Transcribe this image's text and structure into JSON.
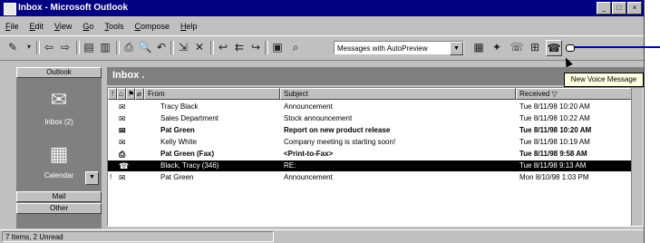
{
  "window": {
    "title": "Inbox - Microsoft Outlook",
    "controls": [
      "_",
      "□",
      "×"
    ]
  },
  "menu": [
    "File",
    "Edit",
    "View",
    "Go",
    "Tools",
    "Compose",
    "Help"
  ],
  "toolbar": {
    "view_selector": "Messages with AutoPreview",
    "tooltip": "New Voice Message"
  },
  "outlook_bar": {
    "header": "Outlook",
    "items": [
      {
        "label": "Inbox (2)",
        "icon": "inbox-icon"
      },
      {
        "label": "Calendar",
        "icon": "calendar-icon"
      }
    ],
    "groups": [
      "Mail",
      "Other"
    ]
  },
  "folder": {
    "title": "Inbox ."
  },
  "columns": {
    "from": "From",
    "subject": "Subject",
    "received": "Received"
  },
  "messages": [
    {
      "from": "Tracy Black",
      "subject": "Announcement",
      "received": "Tue 8/11/98 10:20 AM",
      "icon": "✉",
      "unread": false,
      "selected": false,
      "flag": ""
    },
    {
      "from": "Sales Department",
      "subject": "Stock announcement",
      "received": "Tue 8/11/98 10:22 AM",
      "icon": "✉",
      "unread": false,
      "selected": false,
      "flag": ""
    },
    {
      "from": "Pat Green",
      "subject": "Report on new product release",
      "received": "Tue 8/11/98 10:20 AM",
      "icon": "✉",
      "unread": true,
      "selected": false,
      "flag": ""
    },
    {
      "from": "Kelly White",
      "subject": "Company meeting is starting soon!",
      "received": "Tue 8/11/98 10:19 AM",
      "icon": "✉",
      "unread": false,
      "selected": false,
      "flag": ""
    },
    {
      "from": "Pat Green (Fax)",
      "subject": "<Print-to-Fax>",
      "received": "Tue 8/11/98 9:58 AM",
      "icon": "⎙",
      "unread": true,
      "selected": false,
      "flag": ""
    },
    {
      "from": "Black, Tracy (346)",
      "subject": "RE:",
      "received": "Tue 8/11/98 9:13 AM",
      "icon": "☎",
      "unread": false,
      "selected": true,
      "flag": ""
    },
    {
      "from": "Pat Green",
      "subject": "Announcement",
      "received": "Mon 8/10/98 1:03 PM",
      "icon": "✉",
      "unread": false,
      "selected": false,
      "flag": "!"
    }
  ],
  "status": "7 Items, 2 Unread"
}
